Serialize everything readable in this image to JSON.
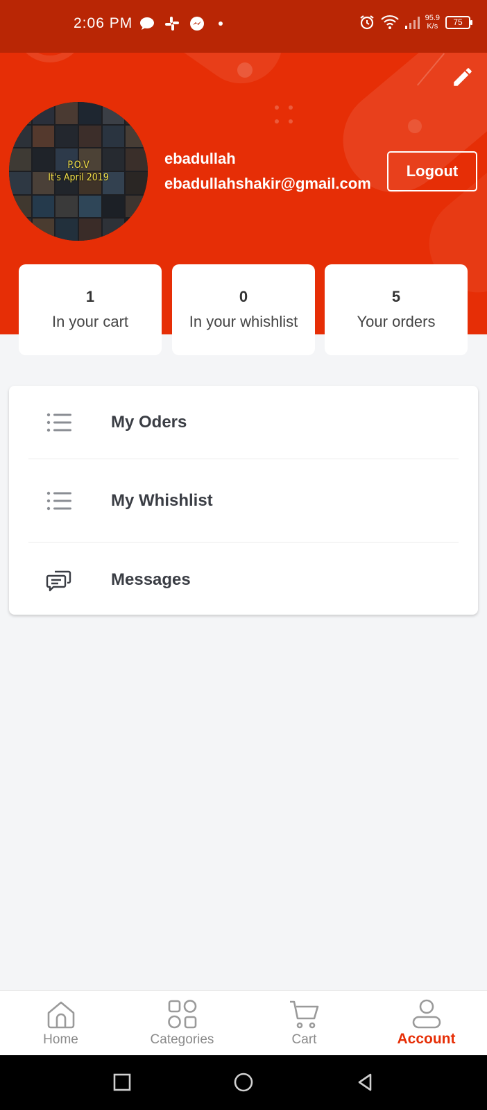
{
  "status_bar": {
    "time": "2:06 PM",
    "net_speed_value": "95.9",
    "net_speed_unit": "K/s",
    "battery": "75"
  },
  "profile": {
    "name": "ebadullah",
    "email": "ebadullahshakir@gmail.com",
    "avatar_text_line1": "P.O.V",
    "avatar_text_line2": "It's April 2019",
    "logout_label": "Logout"
  },
  "stats": [
    {
      "value": "1",
      "label": "In your cart"
    },
    {
      "value": "0",
      "label": "In your whishlist"
    },
    {
      "value": "5",
      "label": "Your orders"
    }
  ],
  "menu": [
    {
      "label": "My Oders",
      "icon": "list-icon"
    },
    {
      "label": "My Whishlist",
      "icon": "list-icon"
    },
    {
      "label": "Messages",
      "icon": "chat-icon"
    }
  ],
  "bottom_nav": [
    {
      "label": "Home",
      "icon": "home-icon"
    },
    {
      "label": "Categories",
      "icon": "grid-icon"
    },
    {
      "label": "Cart",
      "icon": "cart-icon"
    },
    {
      "label": "Account",
      "icon": "user-icon",
      "active": true
    }
  ],
  "colors": {
    "brand": "#e62e06",
    "status_bar": "#b92605",
    "background": "#f4f5f7"
  }
}
